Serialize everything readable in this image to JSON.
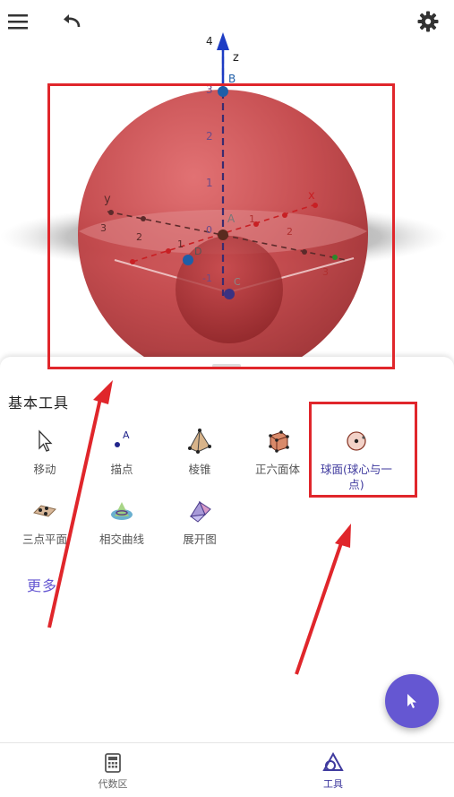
{
  "view3d": {
    "axis_z_label": "z",
    "axis_x_label": "x",
    "axis_y_label": "y",
    "z_ticks": [
      "4",
      "3",
      "2",
      "1",
      "0",
      "-1"
    ],
    "point_labels": [
      "B",
      "A",
      "D",
      "C"
    ],
    "x_ticks": [
      "1",
      "2",
      "3"
    ],
    "y_ticks": [
      "1",
      "2",
      "3"
    ]
  },
  "panel": {
    "title": "基本工具",
    "more": "更多",
    "tools": [
      {
        "label": "移动",
        "icon": "move-arrow-icon"
      },
      {
        "label": "描点",
        "icon": "point-icon"
      },
      {
        "label": "棱锥",
        "icon": "pyramid-icon"
      },
      {
        "label": "正六面体",
        "icon": "cube-icon"
      },
      {
        "label": "球面(球心与一点)",
        "icon": "sphere-icon"
      },
      {
        "label": "三点平面",
        "icon": "plane-three-points-icon"
      },
      {
        "label": "相交曲线",
        "icon": "intersection-curve-icon"
      },
      {
        "label": "展开图",
        "icon": "net-icon"
      }
    ]
  },
  "nav": {
    "algebra": "代数区",
    "tools": "工具"
  },
  "colors": {
    "accent": "#6557d2",
    "annotation": "#e0262b",
    "sphere": "#c0393c"
  }
}
